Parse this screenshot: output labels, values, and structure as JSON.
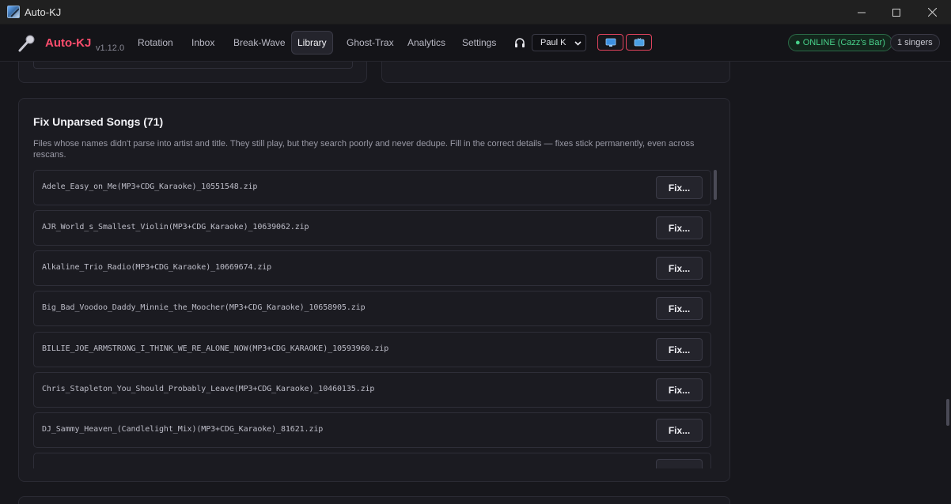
{
  "window": {
    "title": "Auto-KJ"
  },
  "nav": {
    "brand": "Auto-KJ",
    "version": "v1.12.0",
    "tabs": [
      {
        "label": "Rotation"
      },
      {
        "label": "Inbox"
      },
      {
        "label": "Break-Wave"
      },
      {
        "label": "Library"
      },
      {
        "label": "Ghost-Trax"
      },
      {
        "label": "Analytics"
      },
      {
        "label": "Settings"
      }
    ],
    "active_tab": "Library",
    "user": "Paul K",
    "status": "● ONLINE (Cazz's Bar)",
    "singers": "1 singers"
  },
  "fix_unparsed": {
    "title": "Fix Unparsed Songs (71)",
    "description": "Files whose names didn't parse into artist and title. They still play, but they search poorly and never dedupe. Fill in the correct details — fixes stick permanently, even across rescans.",
    "button_label": "Fix...",
    "files": [
      "Adele_Easy_on_Me(MP3+CDG_Karaoke)_10551548.zip",
      "AJR_World_s_Smallest_Violin(MP3+CDG_Karaoke)_10639062.zip",
      "Alkaline_Trio_Radio(MP3+CDG_Karaoke)_10669674.zip",
      "Big_Bad_Voodoo_Daddy_Minnie_the_Moocher(MP3+CDG_Karaoke)_10658905.zip",
      "BILLIE_JOE_ARMSTRONG_I_THINK_WE_RE_ALONE_NOW(MP3+CDG_KARAOKE)_10593960.zip",
      "Chris_Stapleton_You_Should_Probably_Leave(MP3+CDG_Karaoke)_10460135.zip",
      "DJ_Sammy_Heaven_(Candlelight_Mix)(MP3+CDG_Karaoke)_81621.zip"
    ]
  },
  "colors": {
    "accent": "#ff4d6d",
    "online": "#48d08a",
    "background": "#17171c",
    "panel": "#1b1b21"
  },
  "icons": {
    "app": "app-icon",
    "brand": "microphone-icon",
    "headset": "headphones-icon",
    "display1": "monitor-icon",
    "display2": "tv-icon"
  }
}
